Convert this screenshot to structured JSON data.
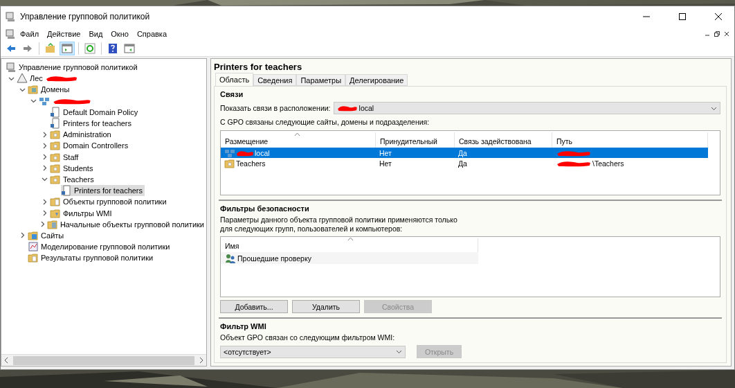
{
  "window": {
    "title": "Управление групповой политикой"
  },
  "menu": [
    {
      "label": "Файл"
    },
    {
      "label": "Действие"
    },
    {
      "label": "Вид"
    },
    {
      "label": "Окно"
    },
    {
      "label": "Справка"
    }
  ],
  "toolbar": [
    {
      "kind": "back",
      "selected": false
    },
    {
      "kind": "forward",
      "selected": false
    },
    {
      "kind": "separator"
    },
    {
      "kind": "up",
      "selected": false
    },
    {
      "kind": "tree",
      "selected": true
    },
    {
      "kind": "separator"
    },
    {
      "kind": "refresh",
      "selected": false
    },
    {
      "kind": "separator"
    },
    {
      "kind": "help",
      "selected": false
    },
    {
      "kind": "pane",
      "selected": false
    }
  ],
  "tree": {
    "label": "Управление групповой политикой",
    "kind": "console",
    "selected": false,
    "children": [
      {
        "label": "Лес",
        "kind": "forest",
        "redacted": true,
        "expanded": true,
        "selected": false,
        "children": [
          {
            "label": "Домены",
            "kind": "domains",
            "expanded": true,
            "selected": false,
            "children": [
              {
                "kind": "domain",
                "redacted": true,
                "expanded": true,
                "selected": false,
                "children": [
                  {
                    "label": "Default Domain Policy",
                    "kind": "gpo",
                    "selected": false
                  },
                  {
                    "label": "Printers for teachers",
                    "kind": "gpo",
                    "selected": false
                  },
                  {
                    "label": "Administration",
                    "kind": "ou",
                    "expanded": false,
                    "selected": false
                  },
                  {
                    "label": "Domain Controllers",
                    "kind": "ou",
                    "expanded": false,
                    "selected": false
                  },
                  {
                    "label": "Staff",
                    "kind": "ou",
                    "expanded": false,
                    "selected": false
                  },
                  {
                    "label": "Students",
                    "kind": "ou",
                    "expanded": false,
                    "selected": false
                  },
                  {
                    "label": "Teachers",
                    "kind": "ou",
                    "expanded": true,
                    "selected": false,
                    "children": [
                      {
                        "label": "Printers for teachers",
                        "kind": "gpo",
                        "selected": true
                      }
                    ]
                  },
                  {
                    "label": "Объекты групповой политики",
                    "kind": "gpofolder",
                    "expanded": false,
                    "selected": false
                  },
                  {
                    "label": "Фильтры WMI",
                    "kind": "wmi",
                    "expanded": false,
                    "selected": false
                  },
                  {
                    "label": "Начальные объекты групповой политики",
                    "kind": "starter",
                    "expanded": false,
                    "selected": false
                  }
                ]
              }
            ]
          },
          {
            "label": "Сайты",
            "kind": "sites",
            "expanded": false,
            "selected": false
          },
          {
            "label": "Моделирование групповой политики",
            "kind": "modeling",
            "selected": false
          },
          {
            "label": "Результаты групповой политики",
            "kind": "results",
            "selected": false
          }
        ]
      }
    ]
  },
  "details": {
    "title": "Printers for teachers",
    "tabs": [
      {
        "label": "Область",
        "selected": true
      },
      {
        "label": "Сведения",
        "selected": false
      },
      {
        "label": "Параметры",
        "selected": false
      },
      {
        "label": "Делегирование",
        "selected": false
      }
    ],
    "links": {
      "heading": "Связи",
      "location_label": "Показать связи в расположении:",
      "location_value": {
        "text": "local",
        "redacted": true
      },
      "table_caption": "С GPO связаны следующие сайты, домены и подразделения:",
      "columns": [
        "Размещение",
        "Принудительный",
        "Связь задействована",
        "Путь"
      ],
      "rows": [
        {
          "selected": true,
          "kind": "domain",
          "cells": [
            {
              "text": "local",
              "redacted": true
            },
            {
              "text": "Нет"
            },
            {
              "text": "Да"
            },
            {
              "redacted": true
            }
          ]
        },
        {
          "selected": false,
          "kind": "ou",
          "cells": [
            {
              "text": "Teachers"
            },
            {
              "text": "Нет"
            },
            {
              "text": "Да"
            },
            {
              "text": "\\Teachers",
              "redacted": true
            }
          ]
        }
      ]
    },
    "security": {
      "heading": "Фильтры безопасности",
      "description": "Параметры данного объекта групповой политики применяются только для следующих групп, пользователей и компьютеров:",
      "column": "Имя",
      "items": [
        {
          "label": "Прошедшие проверку"
        }
      ],
      "buttons": [
        {
          "label": "Добавить...",
          "disabled": false
        },
        {
          "label": "Удалить",
          "disabled": false
        },
        {
          "label": "Свойства",
          "disabled": true
        }
      ]
    },
    "wmi": {
      "heading": "Фильтр WMI",
      "label": "Объект GPO связан со следующим фильтром WMI:",
      "value": "<отсутствует>",
      "button": {
        "label": "Открыть",
        "disabled": true
      }
    }
  }
}
